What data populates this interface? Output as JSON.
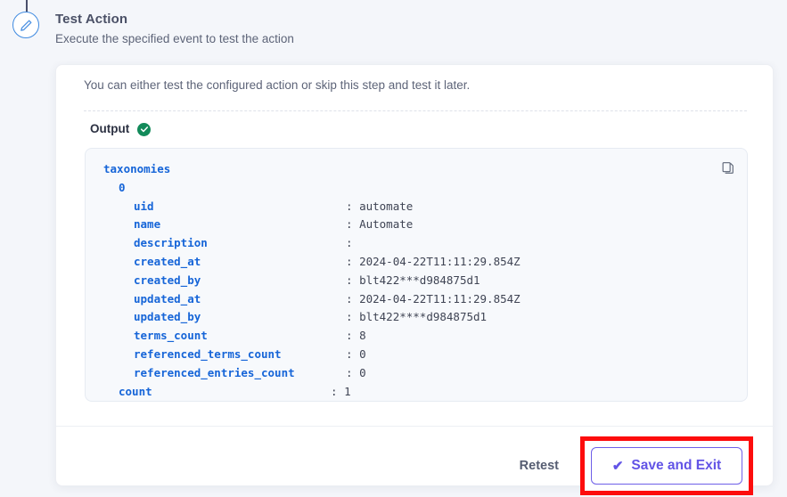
{
  "step": {
    "icon": "pencil-circle-icon",
    "title": "Test Action",
    "subtitle": "Execute the specified event to test the action"
  },
  "card": {
    "intro": "You can either test the configured action or skip this step and test it later.",
    "output_label": "Output",
    "status_icon": "check-circle-icon",
    "copy_icon": "copy-icon"
  },
  "output": {
    "rows": [
      {
        "indent": 0,
        "key": "taxonomies",
        "sep": "",
        "value": ""
      },
      {
        "indent": 1,
        "key": "0",
        "sep": "",
        "value": ""
      },
      {
        "indent": 2,
        "key": "uid",
        "sep": ":",
        "value": "automate"
      },
      {
        "indent": 2,
        "key": "name",
        "sep": ":",
        "value": "Automate"
      },
      {
        "indent": 2,
        "key": "description",
        "sep": ":",
        "value": ""
      },
      {
        "indent": 2,
        "key": "created_at",
        "sep": ":",
        "value": "2024-04-22T11:11:29.854Z"
      },
      {
        "indent": 2,
        "key": "created_by",
        "sep": ":",
        "value": "blt422***d984875d1"
      },
      {
        "indent": 2,
        "key": "updated_at",
        "sep": ":",
        "value": "2024-04-22T11:11:29.854Z"
      },
      {
        "indent": 2,
        "key": "updated_by",
        "sep": ":",
        "value": "blt422****d984875d1"
      },
      {
        "indent": 2,
        "key": "terms_count",
        "sep": ":",
        "value": "8"
      },
      {
        "indent": 2,
        "key": "referenced_terms_count",
        "sep": ":",
        "value": "0"
      },
      {
        "indent": 2,
        "key": "referenced_entries_count",
        "sep": ":",
        "value": "0"
      },
      {
        "indent": 1,
        "key": "count",
        "sep": ":",
        "value": "1"
      }
    ]
  },
  "footer": {
    "retest_label": "Retest",
    "save_label": "Save and Exit",
    "save_check_glyph": "✔",
    "highlight_color": "#fd0d0d",
    "accent_color": "#6254e6"
  }
}
